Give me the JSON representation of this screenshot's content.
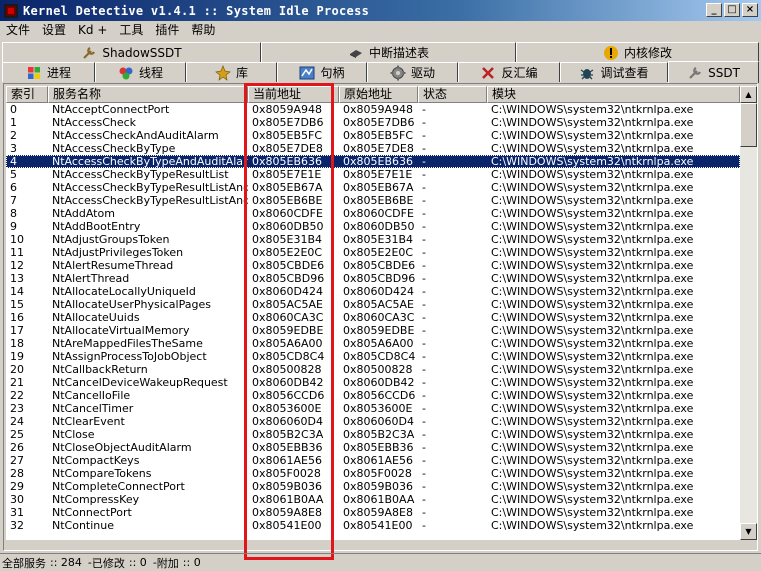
{
  "window": {
    "title": "Kernel Detective v1.4.1 :: System Idle Process",
    "buttons": {
      "minimize": "_",
      "maximize": "□",
      "close": "×"
    }
  },
  "menu": [
    "文件",
    "设置",
    "Kd +",
    "工具",
    "插件",
    "帮助"
  ],
  "tabs_row1": [
    {
      "label": "ShadowSSDT",
      "icon": "wrench-icon"
    },
    {
      "label": "中断描述表",
      "icon": "chip-icon"
    },
    {
      "label": "内核修改",
      "icon": "warning-icon"
    }
  ],
  "tabs_row2": [
    {
      "label": "进程",
      "icon": "windows-icon"
    },
    {
      "label": "线程",
      "icon": "threads-icon"
    },
    {
      "label": "库",
      "icon": "library-icon"
    },
    {
      "label": "句柄",
      "icon": "handle-icon"
    },
    {
      "label": "驱动",
      "icon": "gear-icon"
    },
    {
      "label": "反汇编",
      "icon": "disassemble-icon"
    },
    {
      "label": "调试查看",
      "icon": "debug-icon"
    },
    {
      "label": "SSDT",
      "icon": "wrench-icon"
    }
  ],
  "active_tab": "SSDT",
  "table": {
    "columns": [
      "索引",
      "服务名称",
      "当前地址",
      "原始地址",
      "状态",
      "模块"
    ],
    "selected_index": 4,
    "rows": [
      [
        "0",
        "NtAcceptConnectPort",
        "0x8059A948",
        "0x8059A948",
        "-",
        "C:\\WINDOWS\\system32\\ntkrnlpa.exe"
      ],
      [
        "1",
        "NtAccessCheck",
        "0x805E7DB6",
        "0x805E7DB6",
        "-",
        "C:\\WINDOWS\\system32\\ntkrnlpa.exe"
      ],
      [
        "2",
        "NtAccessCheckAndAuditAlarm",
        "0x805EB5FC",
        "0x805EB5FC",
        "-",
        "C:\\WINDOWS\\system32\\ntkrnlpa.exe"
      ],
      [
        "3",
        "NtAccessCheckByType",
        "0x805E7DE8",
        "0x805E7DE8",
        "-",
        "C:\\WINDOWS\\system32\\ntkrnlpa.exe"
      ],
      [
        "4",
        "NtAccessCheckByTypeAndAuditAlarm",
        "0x805EB636",
        "0x805EB636",
        "-",
        "C:\\WINDOWS\\system32\\ntkrnlpa.exe"
      ],
      [
        "5",
        "NtAccessCheckByTypeResultList",
        "0x805E7E1E",
        "0x805E7E1E",
        "-",
        "C:\\WINDOWS\\system32\\ntkrnlpa.exe"
      ],
      [
        "6",
        "NtAccessCheckByTypeResultListAnd...",
        "0x805EB67A",
        "0x805EB67A",
        "-",
        "C:\\WINDOWS\\system32\\ntkrnlpa.exe"
      ],
      [
        "7",
        "NtAccessCheckByTypeResultListAnd...",
        "0x805EB6BE",
        "0x805EB6BE",
        "-",
        "C:\\WINDOWS\\system32\\ntkrnlpa.exe"
      ],
      [
        "8",
        "NtAddAtom",
        "0x8060CDFE",
        "0x8060CDFE",
        "-",
        "C:\\WINDOWS\\system32\\ntkrnlpa.exe"
      ],
      [
        "9",
        "NtAddBootEntry",
        "0x8060DB50",
        "0x8060DB50",
        "-",
        "C:\\WINDOWS\\system32\\ntkrnlpa.exe"
      ],
      [
        "10",
        "NtAdjustGroupsToken",
        "0x805E31B4",
        "0x805E31B4",
        "-",
        "C:\\WINDOWS\\system32\\ntkrnlpa.exe"
      ],
      [
        "11",
        "NtAdjustPrivilegesToken",
        "0x805E2E0C",
        "0x805E2E0C",
        "-",
        "C:\\WINDOWS\\system32\\ntkrnlpa.exe"
      ],
      [
        "12",
        "NtAlertResumeThread",
        "0x805CBDE6",
        "0x805CBDE6",
        "-",
        "C:\\WINDOWS\\system32\\ntkrnlpa.exe"
      ],
      [
        "13",
        "NtAlertThread",
        "0x805CBD96",
        "0x805CBD96",
        "-",
        "C:\\WINDOWS\\system32\\ntkrnlpa.exe"
      ],
      [
        "14",
        "NtAllocateLocallyUniqueId",
        "0x8060D424",
        "0x8060D424",
        "-",
        "C:\\WINDOWS\\system32\\ntkrnlpa.exe"
      ],
      [
        "15",
        "NtAllocateUserPhysicalPages",
        "0x805AC5AE",
        "0x805AC5AE",
        "-",
        "C:\\WINDOWS\\system32\\ntkrnlpa.exe"
      ],
      [
        "16",
        "NtAllocateUuids",
        "0x8060CA3C",
        "0x8060CA3C",
        "-",
        "C:\\WINDOWS\\system32\\ntkrnlpa.exe"
      ],
      [
        "17",
        "NtAllocateVirtualMemory",
        "0x8059EDBE",
        "0x8059EDBE",
        "-",
        "C:\\WINDOWS\\system32\\ntkrnlpa.exe"
      ],
      [
        "18",
        "NtAreMappedFilesTheSame",
        "0x805A6A00",
        "0x805A6A00",
        "-",
        "C:\\WINDOWS\\system32\\ntkrnlpa.exe"
      ],
      [
        "19",
        "NtAssignProcessToJobObject",
        "0x805CD8C4",
        "0x805CD8C4",
        "-",
        "C:\\WINDOWS\\system32\\ntkrnlpa.exe"
      ],
      [
        "20",
        "NtCallbackReturn",
        "0x80500828",
        "0x80500828",
        "-",
        "C:\\WINDOWS\\system32\\ntkrnlpa.exe"
      ],
      [
        "21",
        "NtCancelDeviceWakeupRequest",
        "0x8060DB42",
        "0x8060DB42",
        "-",
        "C:\\WINDOWS\\system32\\ntkrnlpa.exe"
      ],
      [
        "22",
        "NtCancelIoFile",
        "0x8056CCD6",
        "0x8056CCD6",
        "-",
        "C:\\WINDOWS\\system32\\ntkrnlpa.exe"
      ],
      [
        "23",
        "NtCancelTimer",
        "0x8053600E",
        "0x8053600E",
        "-",
        "C:\\WINDOWS\\system32\\ntkrnlpa.exe"
      ],
      [
        "24",
        "NtClearEvent",
        "0x806060D4",
        "0x806060D4",
        "-",
        "C:\\WINDOWS\\system32\\ntkrnlpa.exe"
      ],
      [
        "25",
        "NtClose",
        "0x805B2C3A",
        "0x805B2C3A",
        "-",
        "C:\\WINDOWS\\system32\\ntkrnlpa.exe"
      ],
      [
        "26",
        "NtCloseObjectAuditAlarm",
        "0x805EBB36",
        "0x805EBB36",
        "-",
        "C:\\WINDOWS\\system32\\ntkrnlpa.exe"
      ],
      [
        "27",
        "NtCompactKeys",
        "0x8061AE56",
        "0x8061AE56",
        "-",
        "C:\\WINDOWS\\system32\\ntkrnlpa.exe"
      ],
      [
        "28",
        "NtCompareTokens",
        "0x805F0028",
        "0x805F0028",
        "-",
        "C:\\WINDOWS\\system32\\ntkrnlpa.exe"
      ],
      [
        "29",
        "NtCompleteConnectPort",
        "0x8059B036",
        "0x8059B036",
        "-",
        "C:\\WINDOWS\\system32\\ntkrnlpa.exe"
      ],
      [
        "30",
        "NtCompressKey",
        "0x8061B0AA",
        "0x8061B0AA",
        "-",
        "C:\\WINDOWS\\system32\\ntkrnlpa.exe"
      ],
      [
        "31",
        "NtConnectPort",
        "0x8059A8E8",
        "0x8059A8E8",
        "-",
        "C:\\WINDOWS\\system32\\ntkrnlpa.exe"
      ],
      [
        "32",
        "NtContinue",
        "0x80541E00",
        "0x80541E00",
        "-",
        "C:\\WINDOWS\\system32\\ntkrnlpa.exe"
      ]
    ]
  },
  "status": {
    "total_label": "全部服务",
    "total_value": ":: 284",
    "modified_label": "已修改",
    "modified_value": ":: 0",
    "attached_label": "附加",
    "attached_value": ":: 0",
    "sep": "-"
  },
  "highlight_color": "#e0161b",
  "selection_color": "#0a246a"
}
